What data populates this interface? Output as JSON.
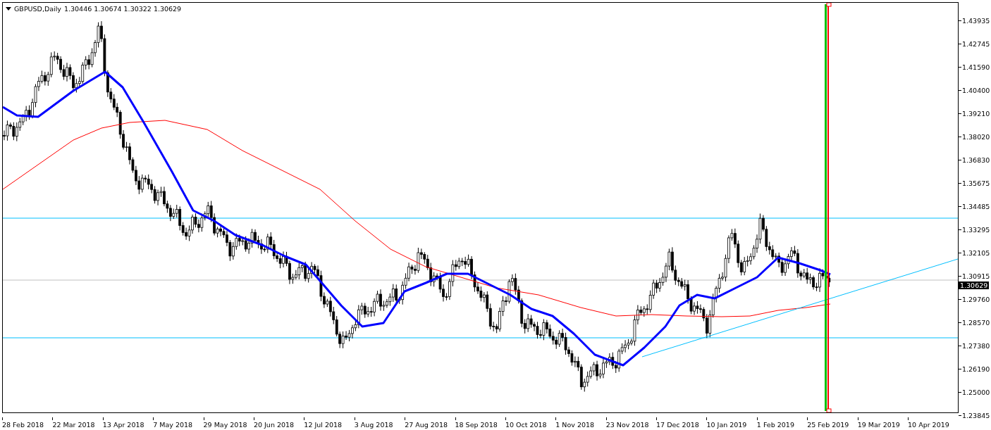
{
  "chart": {
    "symbol": "GBPUSD,Daily",
    "quote": "1.30446 1.30674 1.30322 1.30629",
    "price_axis": [
      "1.43935",
      "1.42745",
      "1.41590",
      "1.40400",
      "1.39210",
      "1.38020",
      "1.36830",
      "1.35675",
      "1.34485",
      "1.33295",
      "1.32105",
      "1.30915",
      "1.29760",
      "1.28570",
      "1.27380",
      "1.26190",
      "1.25000",
      "1.23845"
    ],
    "current_price": "1.30629",
    "time_axis": [
      "28 Feb 2018",
      "22 Mar 2018",
      "13 Apr 2018",
      "7 May 2018",
      "29 May 2018",
      "20 Jun 2018",
      "12 Jul 2018",
      "3 Aug 2018",
      "27 Aug 2018",
      "18 Sep 2018",
      "10 Oct 2018",
      "1 Nov 2018",
      "23 Nov 2018",
      "17 Dec 2018",
      "10 Jan 2019",
      "1 Feb 2019",
      "25 Feb 2019",
      "19 Mar 2019",
      "10 Apr 2019"
    ]
  }
}
